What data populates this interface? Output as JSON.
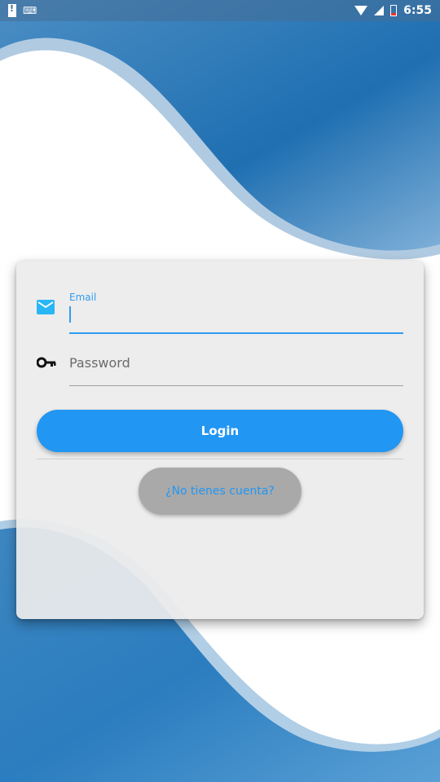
{
  "status_bar": {
    "time": "6:55",
    "icons": [
      "battery-alert-icon",
      "keyboard-icon",
      "wifi-icon",
      "signal-icon",
      "battery-icon"
    ]
  },
  "login_form": {
    "email": {
      "label": "Email",
      "value": "",
      "icon": "mail-icon"
    },
    "password": {
      "placeholder": "Password",
      "value": "",
      "icon": "key-icon"
    },
    "login_button_label": "Login",
    "signup_link_label": "¿No tienes cuenta?"
  },
  "colors": {
    "primary": "#2196f3",
    "wave_blue": "#1a6eb5",
    "card_background": "#ececec",
    "secondary_button": "#a9a9a9"
  }
}
